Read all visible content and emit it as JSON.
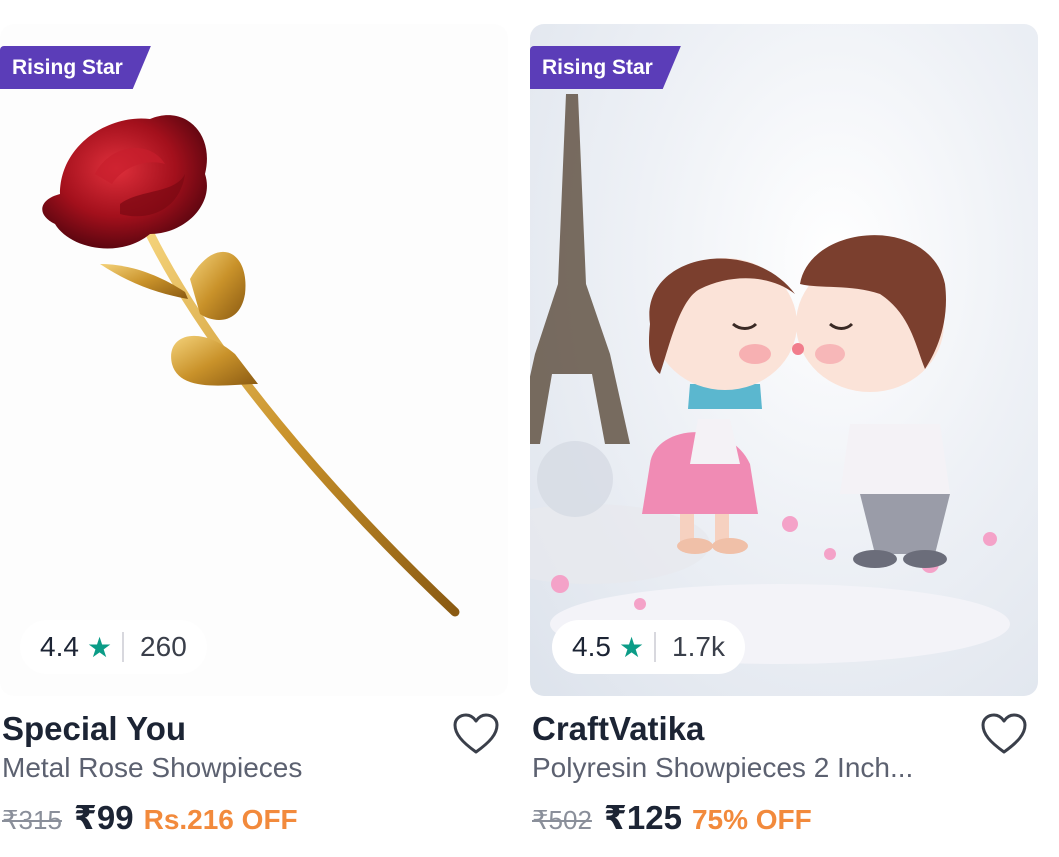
{
  "products": [
    {
      "badge": "Rising Star",
      "rating": "4.4",
      "rating_count": "260",
      "brand": "Special You",
      "name": "Metal Rose Showpieces",
      "mrp": "₹315",
      "price": "₹99",
      "discount": "Rs.216 OFF"
    },
    {
      "badge": "Rising Star",
      "rating": "4.5",
      "rating_count": "1.7k",
      "brand": "CraftVatika",
      "name": "Polyresin Showpieces 2 Inch...",
      "mrp": "₹502",
      "price": "₹125",
      "discount": "75% OFF"
    }
  ],
  "icons": {
    "rating": "star-icon",
    "wishlist": "heart-outline-icon"
  },
  "colors": {
    "badge_bg": "#5b3db8",
    "star": "#0b9c87",
    "discount": "#f28a3c",
    "text_primary": "#1c2434",
    "text_secondary": "#5c6170"
  }
}
